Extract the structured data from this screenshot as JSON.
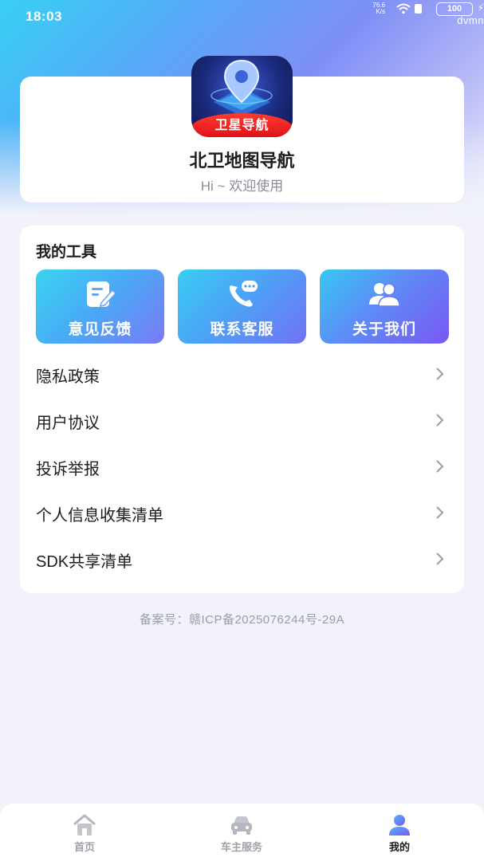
{
  "status_bar": {
    "time": "18:03",
    "net_speed_value": "76.6",
    "net_speed_unit": "K/s",
    "battery": "100",
    "watermark": "dvmn"
  },
  "header": {
    "logo_text": "卫星导航",
    "app_name": "北卫地图导航",
    "welcome": "Hi ~ 欢迎使用"
  },
  "tools": {
    "title": "我的工具",
    "buttons": [
      {
        "label": "意见反馈",
        "icon": "feedback-edit-icon"
      },
      {
        "label": "联系客服",
        "icon": "phone-chat-icon"
      },
      {
        "label": "关于我们",
        "icon": "users-icon"
      }
    ]
  },
  "menu": {
    "items": [
      {
        "label": "隐私政策"
      },
      {
        "label": "用户协议"
      },
      {
        "label": "投诉举报"
      },
      {
        "label": "个人信息收集清单"
      },
      {
        "label": "SDK共享清单"
      }
    ]
  },
  "footer": {
    "icp": "备案号：赣ICP备2025076244号-29A"
  },
  "bottom_nav": {
    "items": [
      {
        "label": "首页",
        "icon": "home-icon",
        "active": false
      },
      {
        "label": "车主服务",
        "icon": "car-icon",
        "active": false
      },
      {
        "label": "我的",
        "icon": "profile-icon",
        "active": true
      }
    ]
  },
  "colors": {
    "accent_blue": "#4aa8f5",
    "accent_purple": "#7a57f3",
    "logo_red": "#e0141a",
    "page_bg": "#f2f3fa"
  }
}
